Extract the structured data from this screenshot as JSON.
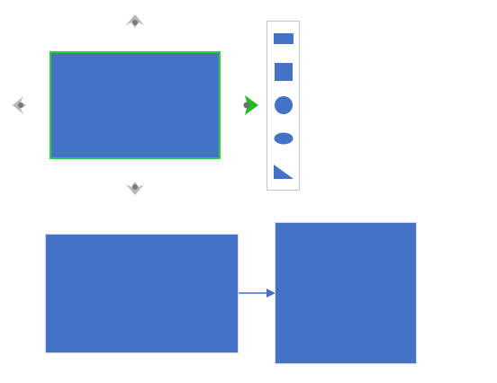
{
  "colors": {
    "shape_fill": "#4472c4",
    "selection_border": "#2ecc40",
    "arrow_inactive": "#b9b9b9",
    "arrow_active": "#22bb22",
    "toolbar_border": "#c8c8c8"
  },
  "selected_shape": {
    "type": "rectangle",
    "selected": true
  },
  "auto_connect_arrows": [
    {
      "direction": "up",
      "state": "inactive",
      "icon": "chevron-up-icon"
    },
    {
      "direction": "down",
      "state": "inactive",
      "icon": "chevron-down-icon"
    },
    {
      "direction": "left",
      "state": "inactive",
      "icon": "chevron-left-icon"
    },
    {
      "direction": "right",
      "state": "active",
      "icon": "chevron-right-icon"
    }
  ],
  "quick_shapes_toolbar": {
    "items": [
      {
        "shape": "rectangle",
        "icon": "rectangle-icon"
      },
      {
        "shape": "square",
        "icon": "square-icon"
      },
      {
        "shape": "circle",
        "icon": "circle-icon"
      },
      {
        "shape": "ellipse",
        "icon": "ellipse-icon"
      },
      {
        "shape": "right-triangle",
        "icon": "triangle-icon"
      }
    ]
  },
  "diagram": {
    "shapes": [
      {
        "id": "shape-a",
        "type": "rectangle"
      },
      {
        "id": "shape-b",
        "type": "square"
      }
    ],
    "connectors": [
      {
        "from": "shape-a",
        "to": "shape-b",
        "style": "arrow"
      }
    ]
  }
}
